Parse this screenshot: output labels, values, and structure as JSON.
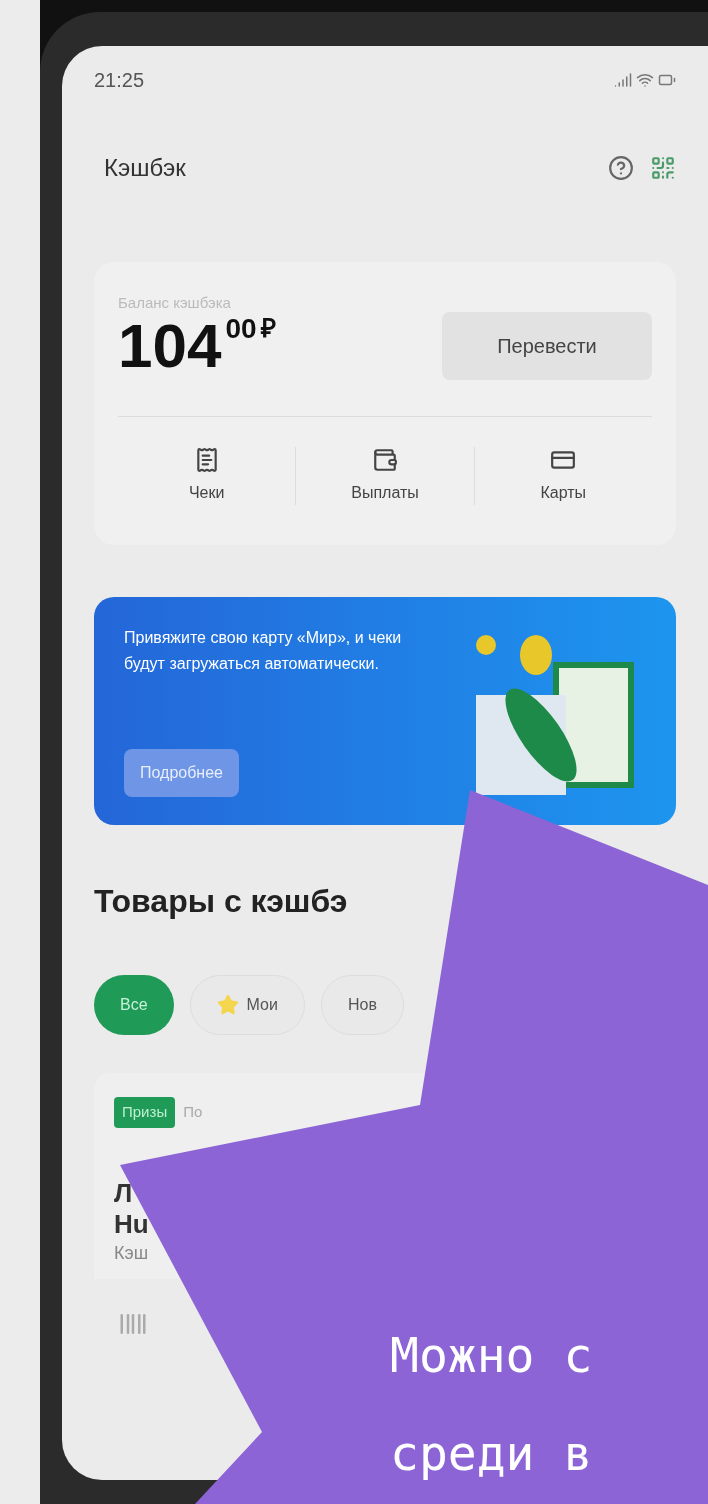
{
  "status_bar": {
    "time": "21:25"
  },
  "header": {
    "title": "Кэшбэк"
  },
  "balance": {
    "label": "Баланс кэшбэка",
    "amount": "104",
    "fraction": "00",
    "currency": "₽",
    "action": "Перевести"
  },
  "shortcuts": [
    {
      "kind": "receipts",
      "label": "Чеки"
    },
    {
      "kind": "payouts",
      "label": "Выплаты"
    },
    {
      "kind": "cards",
      "label": "Карты"
    }
  ],
  "banner": {
    "text": "Привяжите свою карту «Мир», и чеки будут загружаться автоматически.",
    "button": "Подробнее"
  },
  "section": {
    "title": "Товары с кэшбэ"
  },
  "filters": [
    {
      "label": "Все",
      "selected": true,
      "starred": false
    },
    {
      "label": "Мои",
      "selected": false,
      "starred": true
    },
    {
      "label": "Нов",
      "selected": false,
      "starred": false
    }
  ],
  "product": {
    "tag": "Призы",
    "note": "По",
    "name_lines": [
      "Л",
      "Hu"
    ],
    "cashback": "Кэш"
  },
  "overlay": {
    "lines": [
      "Можно с",
      "среди в"
    ]
  }
}
